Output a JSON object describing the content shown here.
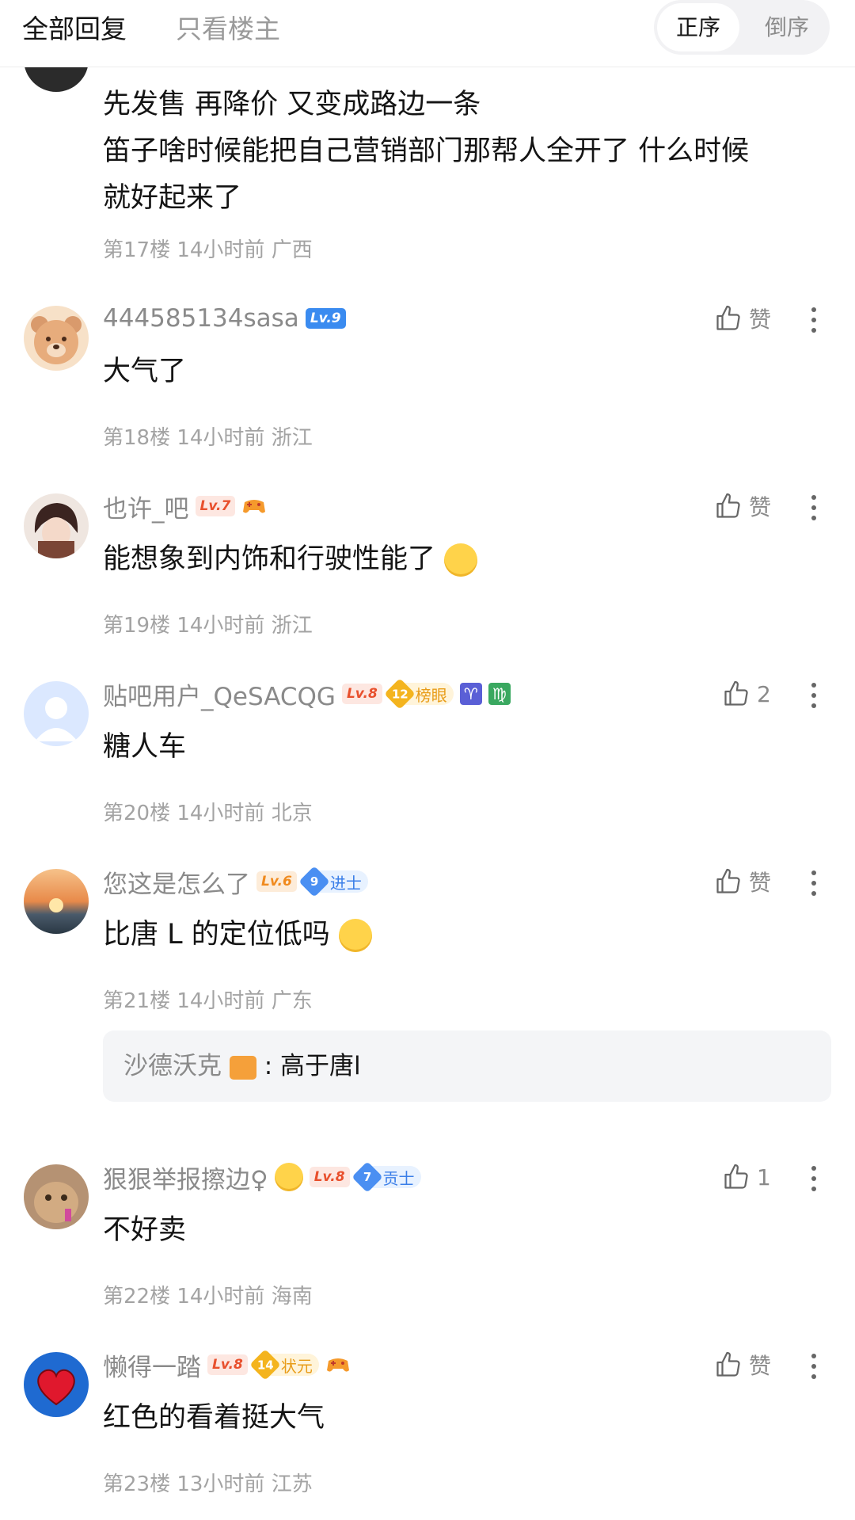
{
  "header": {
    "tab_all": "全部回复",
    "tab_op": "只看楼主",
    "sort_asc": "正序",
    "sort_desc": "倒序"
  },
  "partial_comment": {
    "lines": [
      "先发售 再降价 又变成路边一条",
      "笛子啥时候能把自己营销部门那帮人全开了 什么时候",
      "就好起来了"
    ],
    "meta": "第17楼 14小时前 广西"
  },
  "comments": [
    {
      "username": "444585134sasa",
      "level": "Lv.9",
      "text": "大气了",
      "meta": "第18楼 14小时前 浙江",
      "like": "赞"
    },
    {
      "username": "也许_吧",
      "level": "Lv.7",
      "text": "能想象到内饰和行驶性能了",
      "meta": "第19楼 14小时前 浙江",
      "like": "赞"
    },
    {
      "username": "贴吧用户_QeSACQG",
      "level": "Lv.8",
      "badge_num": "12",
      "badge_label": "榜眼",
      "zodiac": [
        "♈",
        "♍"
      ],
      "text": "糖人车",
      "meta": "第20楼 14小时前 北京",
      "like": "2"
    },
    {
      "username": "您这是怎么了",
      "level": "Lv.6",
      "badge_num": "9",
      "badge_label": "进士",
      "text": "比唐 L 的定位低吗",
      "meta": "第21楼 14小时前 广东",
      "like": "赞",
      "reply": {
        "name": "沙德沃克",
        "text": ": 高于唐l"
      }
    },
    {
      "username": "狠狠举报擦边♀",
      "level": "Lv.8",
      "badge_num": "7",
      "badge_label": "贡士",
      "text": "不好卖",
      "meta": "第22楼 14小时前 海南",
      "like": "1"
    },
    {
      "username": "懒得一踏",
      "level": "Lv.8",
      "badge_num": "14",
      "badge_label": "状元",
      "text": "红色的看着挺大气",
      "meta": "第23楼 13小时前 江苏",
      "like": "赞"
    }
  ],
  "colors": {
    "accent_blue": "#3a8bf0",
    "level_red": "#e8502d",
    "gold": "#f4b41e"
  }
}
